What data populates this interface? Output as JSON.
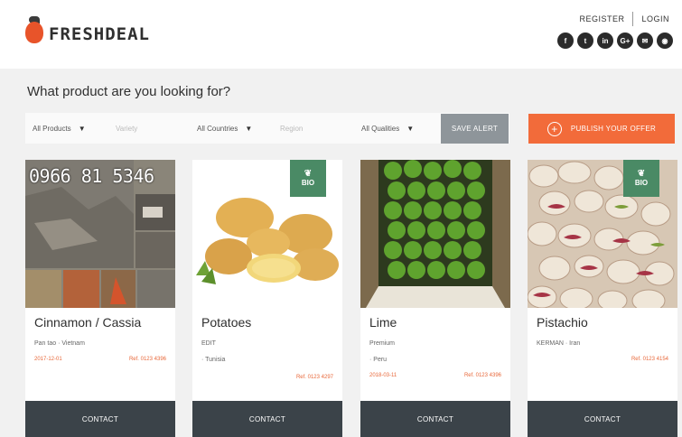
{
  "header": {
    "brand": "FRESHDEAL",
    "register": "REGISTER",
    "login": "LOGIN",
    "social": [
      {
        "icon": "facebook-icon",
        "glyph": "f"
      },
      {
        "icon": "twitter-icon",
        "glyph": "t"
      },
      {
        "icon": "linkedin-icon",
        "glyph": "in"
      },
      {
        "icon": "googleplus-icon",
        "glyph": "G+"
      },
      {
        "icon": "email-icon",
        "glyph": "✉"
      },
      {
        "icon": "rss-icon",
        "glyph": "◉"
      }
    ]
  },
  "search": {
    "question": "What product are you looking for?",
    "products": "All Products",
    "variety_placeholder": "Variety",
    "countries": "All Countries",
    "region_placeholder": "Region",
    "qualities": "All Qualities",
    "save_alert": "SAVE ALERT",
    "publish": "PUBLISH YOUR OFFER"
  },
  "cards": [
    {
      "name": "Cinnamon / Cassia",
      "sub1": "Pan tao · Vietnam",
      "sub2": "",
      "date": "2017-12-01",
      "ref": "Ref. 0123 4396",
      "contact": "CONTACT",
      "overlay": "0966 81 5346",
      "bio": false
    },
    {
      "name": "Potatoes",
      "sub1": "EDIT",
      "sub2": "· Tunisia",
      "date": "",
      "ref": "Ref. 0123 4297",
      "contact": "CONTACT",
      "overlay": "",
      "bio": true,
      "bio_label": "BIO"
    },
    {
      "name": "Lime",
      "sub1": "Premium",
      "sub2": "· Peru",
      "date": "2018-03-11",
      "ref": "Ref. 0123 4396",
      "contact": "CONTACT",
      "overlay": "",
      "bio": false
    },
    {
      "name": "Pistachio",
      "sub1": "KERMAN · Iran",
      "sub2": "",
      "date": "",
      "ref": "Ref. 0123 4154",
      "contact": "CONTACT",
      "overlay": "",
      "bio": true,
      "bio_label": "BIO"
    }
  ],
  "colors": {
    "accent": "#f26b3a",
    "contact_bg": "#3b4349",
    "bio_green": "#4a8a65"
  }
}
